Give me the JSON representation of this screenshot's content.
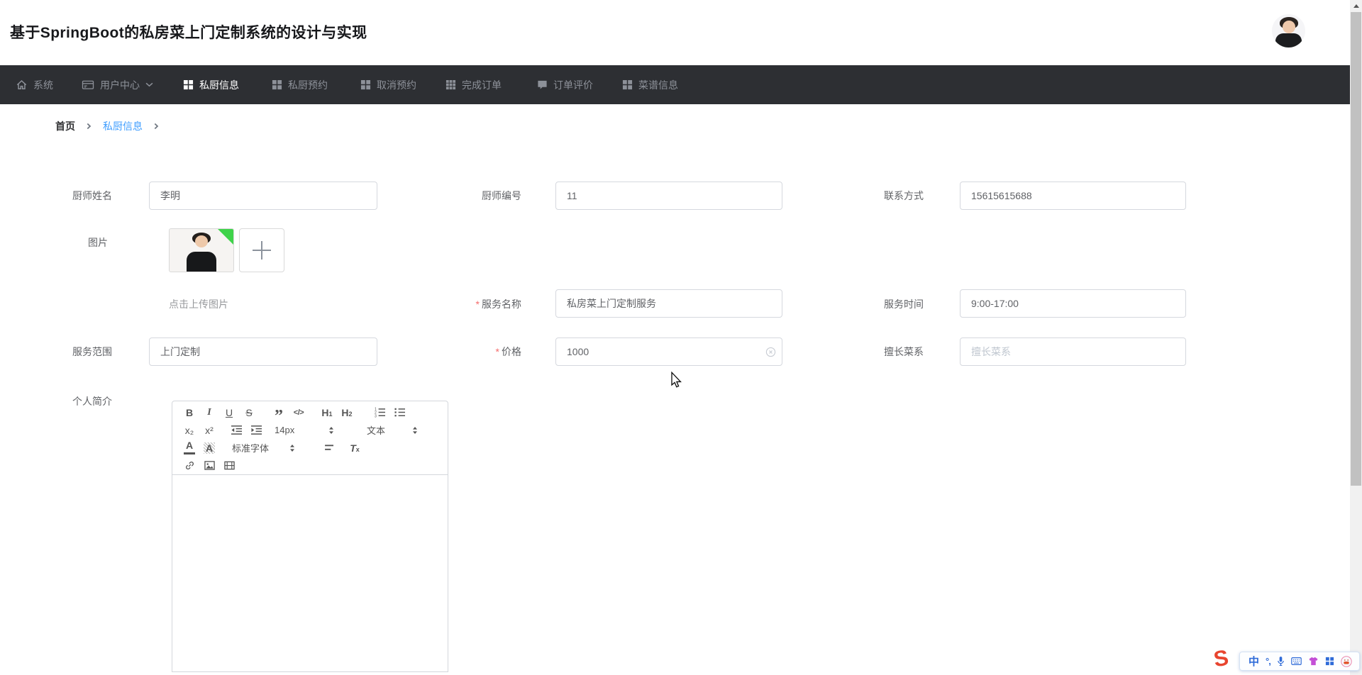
{
  "header": {
    "title": "基于SpringBoot的私房菜上门定制系统的设计与实现"
  },
  "nav": {
    "items": [
      {
        "label": "系统",
        "active": false
      },
      {
        "label": "用户中心",
        "active": false
      },
      {
        "label": "私厨信息",
        "active": true
      },
      {
        "label": "私厨预约",
        "active": false
      },
      {
        "label": "取消预约",
        "active": false
      },
      {
        "label": "完成订单",
        "active": false
      },
      {
        "label": "订单评价",
        "active": false
      },
      {
        "label": "菜谱信息",
        "active": false
      }
    ]
  },
  "breadcrumb": {
    "home": "首页",
    "current": "私厨信息"
  },
  "form": {
    "required_marker": "*",
    "chef_name": {
      "label": "厨师姓名",
      "value": "李明"
    },
    "chef_no": {
      "label": "厨师编号",
      "value": "11"
    },
    "contact": {
      "label": "联系方式",
      "value": "15615615688"
    },
    "image": {
      "label": "图片",
      "hint": "点击上传图片"
    },
    "service_name": {
      "label": "服务名称",
      "value": "私房菜上门定制服务",
      "required": true
    },
    "service_time": {
      "label": "服务时间",
      "value": "9:00-17:00"
    },
    "service_scope": {
      "label": "服务范围",
      "value": "上门定制"
    },
    "price": {
      "label": "价格",
      "value": "1000",
      "required": true
    },
    "cuisine": {
      "label": "擅长菜系",
      "placeholder": "擅长菜系"
    },
    "intro": {
      "label": "个人简介"
    }
  },
  "editor": {
    "toolbar": {
      "bold": "B",
      "italic": "I",
      "underline": "U",
      "strike": "S",
      "quote": "”",
      "code": "</>",
      "h": "H",
      "h1_digit": "1",
      "h2_digit": "2",
      "subscript": "x₂",
      "superscript": "x²",
      "size_value": "14px",
      "format_value": "文本",
      "color": "A",
      "highlight": "A",
      "font_value": "标准字体",
      "clear_t": "T",
      "clear_x": "x"
    }
  },
  "ime": {
    "logo": "S",
    "mode_chinese": "中",
    "punctuation": "°,"
  },
  "colors": {
    "nav_bg": "#2d2f33",
    "link_blue": "#409eff",
    "required_red": "#f56c6c",
    "thumb_corner_green": "#3fd34a",
    "ime_blue": "#2f6bd8",
    "sogou_red": "#e8452f"
  }
}
